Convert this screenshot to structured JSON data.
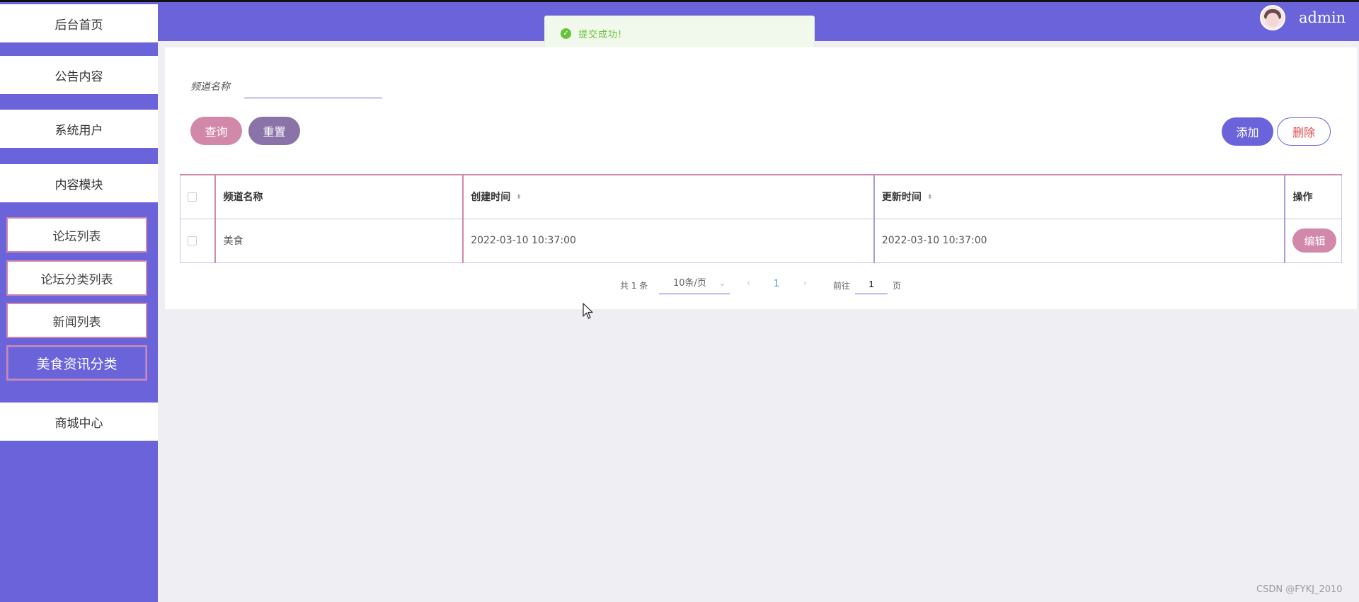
{
  "sidebar": {
    "items": [
      {
        "label": "后台首页"
      },
      {
        "label": "公告内容"
      },
      {
        "label": "系统用户"
      },
      {
        "label": "内容模块"
      },
      {
        "label": "商城中心"
      }
    ],
    "sub_items": [
      {
        "label": "论坛列表"
      },
      {
        "label": "论坛分类列表"
      },
      {
        "label": "新闻列表"
      },
      {
        "label": "美食资讯分类"
      }
    ],
    "active": "美食资讯分类"
  },
  "header": {
    "username": "admin"
  },
  "toast": {
    "message": "提交成功!"
  },
  "search": {
    "label": "频道名称",
    "value": ""
  },
  "buttons": {
    "query": "查询",
    "reset": "重置",
    "add": "添加",
    "delete": "删除",
    "edit": "编辑"
  },
  "table": {
    "columns": [
      "频道名称",
      "创建时间",
      "更新时间",
      "操作"
    ],
    "rows": [
      {
        "name": "美食",
        "created": "2022-03-10 10:37:00",
        "updated": "2022-03-10 10:37:00"
      }
    ]
  },
  "pagination": {
    "total": "共 1 条",
    "page_size": "10条/页",
    "current_page": "1",
    "goto_label": "前往",
    "goto_value": "1",
    "unit": "页"
  },
  "watermark": "CSDN @FYKJ_2010",
  "colors": {
    "primary": "#6b63d9",
    "pink": "#d288a9",
    "success": "#67c23a",
    "danger": "#e24c4c"
  }
}
